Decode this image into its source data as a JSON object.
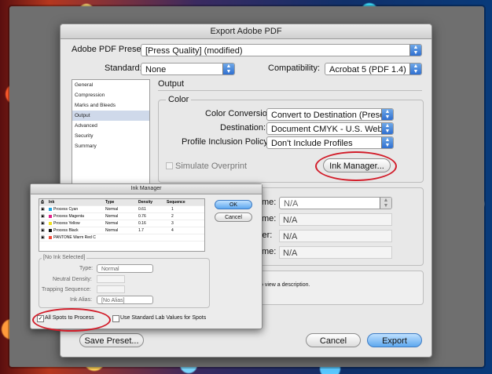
{
  "dialog": {
    "title": "Export Adobe PDF",
    "preset_label": "Adobe PDF Preset:",
    "preset_value": "[Press Quality] (modified)",
    "standard_label": "Standard:",
    "standard_value": "None",
    "compat_label": "Compatibility:",
    "compat_value": "Acrobat 5 (PDF 1.4)",
    "sidebar": [
      "General",
      "Compression",
      "Marks and Bleeds",
      "Output",
      "Advanced",
      "Security",
      "Summary"
    ],
    "sidebar_selected": "Output",
    "section_title": "Output",
    "color_group": "Color",
    "color_conversion_label": "Color Conversion:",
    "color_conversion_value": "Convert to Destination (Prese...",
    "destination_label": "Destination:",
    "destination_value": "Document CMYK - U.S. Web...",
    "profile_label": "Profile Inclusion Policy:",
    "profile_value": "Don't Include Profiles",
    "simulate_label": "Simulate Overprint",
    "ink_manager_button": "Ink Manager...",
    "pdfx_fields": [
      {
        "label": "me:",
        "value": "N/A",
        "dropdown": true
      },
      {
        "label": "me:",
        "value": "N/A",
        "dropdown": false
      },
      {
        "label": "fier:",
        "value": "N/A",
        "dropdown": false
      },
      {
        "label": "me:",
        "value": "N/A",
        "dropdown": false
      }
    ],
    "description_fragment": "o view a description.",
    "save_preset_button": "Save Preset...",
    "cancel_button": "Cancel",
    "export_button": "Export"
  },
  "ink_manager": {
    "title": "Ink Manager",
    "headers": [
      "Ink",
      "Type",
      "Density",
      "Sequence"
    ],
    "inks": [
      {
        "name": "Process Cyan",
        "type": "Normal",
        "density": "0.61",
        "sequence": "1",
        "color": "#1fa4e0"
      },
      {
        "name": "Process Magenta",
        "type": "Normal",
        "density": "0.76",
        "sequence": "2",
        "color": "#e0208a"
      },
      {
        "name": "Process Yellow",
        "type": "Normal",
        "density": "0.16",
        "sequence": "3",
        "color": "#f0e020"
      },
      {
        "name": "Process Black",
        "type": "Normal",
        "density": "1.7",
        "sequence": "4",
        "color": "#111111"
      },
      {
        "name": "PANTONE Warm Red C",
        "type": "",
        "density": "",
        "sequence": "",
        "color": "#f04a3a"
      }
    ],
    "ok_button": "OK",
    "cancel_button": "Cancel",
    "selection_label": "[No Ink Selected]",
    "type_label": "Type:",
    "type_value": "Normal",
    "neutral_density_label": "Neutral Density:",
    "trapping_label": "Trapping Sequence:",
    "ink_alias_label": "Ink Alias:",
    "ink_alias_value": "[No Alias]",
    "all_spots_label": "All Spots to Process",
    "lab_values_label": "Use Standard Lab Values for Spots"
  },
  "colors": {
    "accent": "#3d7bc3",
    "annotation": "#d21d2a"
  }
}
